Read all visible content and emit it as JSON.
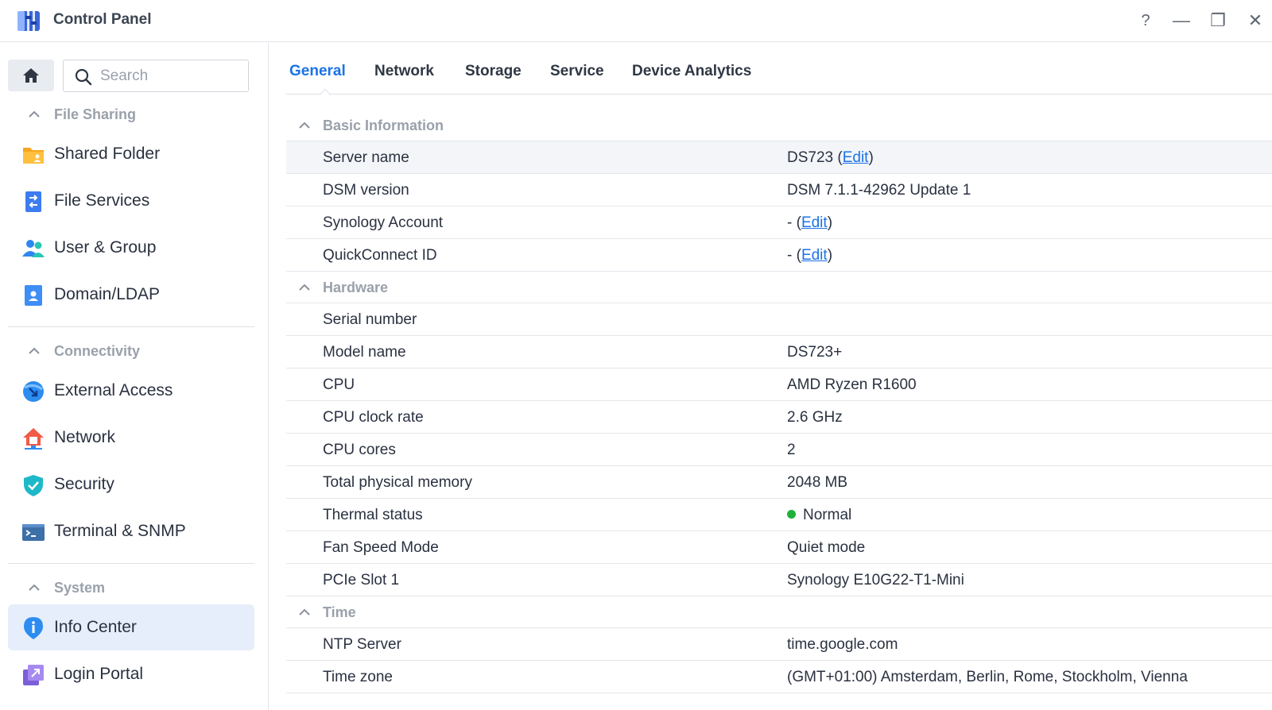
{
  "window": {
    "title": "Control Panel",
    "controls": {
      "help": "?",
      "minimize": "—",
      "restore": "❐",
      "close": "✕"
    }
  },
  "sidebar": {
    "search_placeholder": "Search",
    "groups": [
      {
        "label": "File Sharing",
        "items": [
          {
            "label": "Shared Folder",
            "icon": "shared-folder-icon"
          },
          {
            "label": "File Services",
            "icon": "file-services-icon"
          },
          {
            "label": "User & Group",
            "icon": "user-group-icon"
          },
          {
            "label": "Domain/LDAP",
            "icon": "domain-ldap-icon"
          }
        ]
      },
      {
        "label": "Connectivity",
        "items": [
          {
            "label": "External Access",
            "icon": "external-access-icon"
          },
          {
            "label": "Network",
            "icon": "network-icon"
          },
          {
            "label": "Security",
            "icon": "security-shield-icon"
          },
          {
            "label": "Terminal & SNMP",
            "icon": "terminal-icon"
          }
        ]
      },
      {
        "label": "System",
        "items": [
          {
            "label": "Info Center",
            "icon": "info-center-icon",
            "active": true
          },
          {
            "label": "Login Portal",
            "icon": "login-portal-icon"
          }
        ]
      }
    ]
  },
  "tabs": [
    {
      "label": "General",
      "active": true
    },
    {
      "label": "Network"
    },
    {
      "label": "Storage"
    },
    {
      "label": "Service"
    },
    {
      "label": "Device Analytics"
    }
  ],
  "info": {
    "basic": {
      "title": "Basic Information",
      "server_name_label": "Server name",
      "server_name_value": "DS723",
      "dsm_version_label": "DSM version",
      "dsm_version_value": "DSM 7.1.1-42962 Update 1",
      "synology_account_label": "Synology Account",
      "synology_account_value": "-",
      "quickconnect_label": "QuickConnect ID",
      "quickconnect_value": "-",
      "edit_link": "Edit",
      "paren_open": "(",
      "paren_close": ")"
    },
    "hardware": {
      "title": "Hardware",
      "serial_label": "Serial number",
      "serial_value": "",
      "model_label": "Model name",
      "model_value": "DS723+",
      "cpu_label": "CPU",
      "cpu_value": "AMD Ryzen R1600",
      "clock_label": "CPU clock rate",
      "clock_value": "2.6 GHz",
      "cores_label": "CPU cores",
      "cores_value": "2",
      "memory_label": "Total physical memory",
      "memory_value": "2048 MB",
      "thermal_label": "Thermal status",
      "thermal_value": "Normal",
      "thermal_color": "#1f9b33",
      "fan_label": "Fan Speed Mode",
      "fan_value": "Quiet mode",
      "pcie_label": "PCIe Slot 1",
      "pcie_value": "Synology E10G22-T1-Mini"
    },
    "time": {
      "title": "Time",
      "ntp_label": "NTP Server",
      "ntp_value": "time.google.com",
      "tz_label": "Time zone",
      "tz_value": "(GMT+01:00) Amsterdam, Berlin, Rome, Stockholm, Vienna"
    }
  },
  "colors": {
    "accent": "#1a73e8",
    "active_item_bg": "#e6eefb",
    "section_header": "#9aa1ab",
    "status_ok": "#1db13a"
  }
}
